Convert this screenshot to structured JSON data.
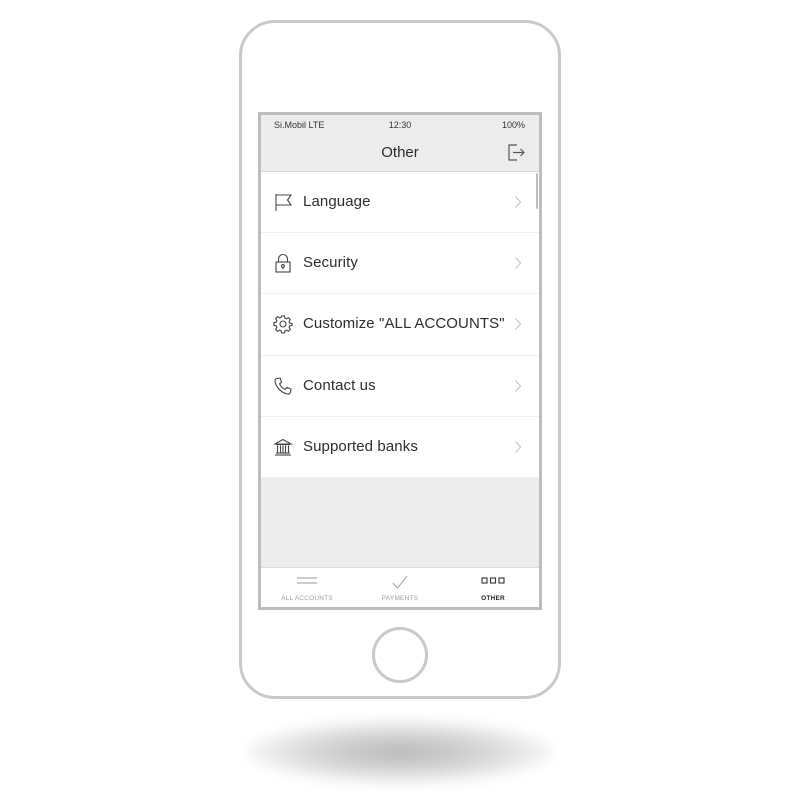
{
  "status_bar": {
    "carrier": "Si.Mobil LTE",
    "time": "12:30",
    "battery": "100%"
  },
  "header": {
    "title": "Other",
    "logout_icon": "logout-icon"
  },
  "menu": {
    "items": [
      {
        "label": "Language",
        "icon": "flag-icon"
      },
      {
        "label": "Security",
        "icon": "lock-icon"
      },
      {
        "label": "Customize \"ALL ACCOUNTS\"",
        "icon": "gear-icon"
      },
      {
        "label": "Contact us",
        "icon": "phone-icon"
      },
      {
        "label": "Supported banks",
        "icon": "bank-icon"
      }
    ],
    "chevron_icon": "chevron-right-icon"
  },
  "tab_bar": {
    "tabs": [
      {
        "label": "ALL ACCOUNTS",
        "icon": "menu-lines-icon",
        "active": false
      },
      {
        "label": "PAYMENTS",
        "icon": "checkmark-icon",
        "active": false
      },
      {
        "label": "OTHER",
        "icon": "three-squares-icon",
        "active": true
      }
    ]
  },
  "colors": {
    "header_background": "#ececec",
    "screen_background": "#ececec",
    "device_frame": "#c9c9c9",
    "text_primary": "#2d2d2d",
    "tab_inactive": "#9a9a9a",
    "tab_active": "#222222"
  }
}
